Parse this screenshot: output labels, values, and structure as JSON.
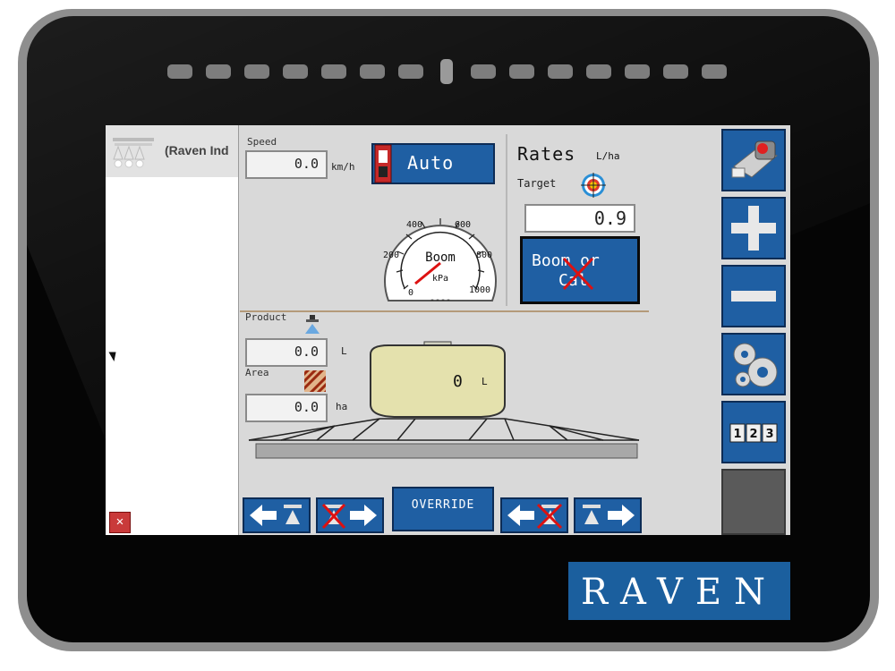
{
  "brand": {
    "logo_text": "RAVEN",
    "accent": "#1f5fa3",
    "logo_bg": "#1b5f9e"
  },
  "left_panel": {
    "title": "(Raven Ind",
    "close_label": "✕"
  },
  "speed": {
    "label": "Speed",
    "value": "0.0",
    "unit": "km/h"
  },
  "mode_button": {
    "label": "Auto"
  },
  "gauge": {
    "label": "Boom",
    "unit": "kPa",
    "ticks": [
      "0",
      "200",
      "400",
      "600",
      "800",
      "1000"
    ],
    "dashes": "----",
    "value_kpa": 0
  },
  "rates": {
    "title": "Rates",
    "unit": "L/ha",
    "target_label": "Target",
    "target_value": "0.9"
  },
  "cal_button": {
    "line1": "Boom or",
    "line2": "Cal"
  },
  "product": {
    "label": "Product",
    "value": "0.0",
    "unit": "L"
  },
  "area": {
    "label": "Area",
    "value": "0.0",
    "unit": "ha"
  },
  "tank": {
    "value": "0",
    "unit": "L"
  },
  "override": {
    "label": "OVERRIDE"
  },
  "toolbar": {
    "icons": [
      "master-switch-icon",
      "plus-icon",
      "minus-icon",
      "gears-icon",
      "counter-icon"
    ],
    "counter_digits": [
      "1",
      "2",
      "3"
    ]
  }
}
